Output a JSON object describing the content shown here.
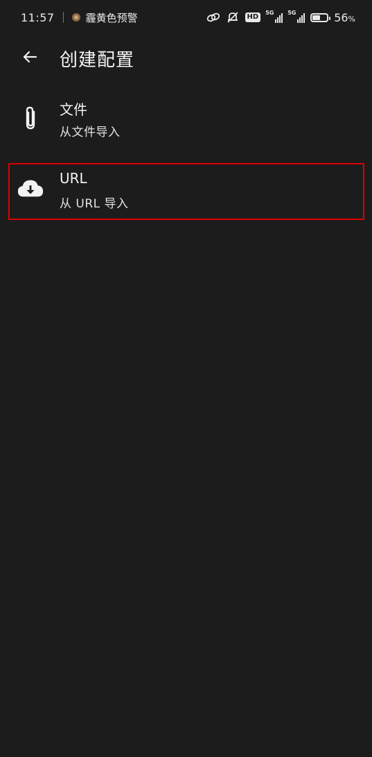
{
  "status_bar": {
    "time": "11:57",
    "alert_text": "霾黄色预警",
    "hd_label": "HD",
    "network_1": "5G",
    "network_2": "5G",
    "battery_percent": "56",
    "battery_unit": "%",
    "battery_level": 0.56,
    "icons": [
      "link-icon",
      "mute-icon",
      "hd-icon",
      "signal-icon",
      "battery-icon"
    ]
  },
  "app_bar": {
    "back_icon": "arrow-left-icon",
    "title": "创建配置"
  },
  "options": [
    {
      "icon": "paperclip-icon",
      "title": "文件",
      "subtitle": "从文件导入"
    },
    {
      "icon": "cloud-download-icon",
      "title": "URL",
      "subtitle": "从 URL 导入"
    }
  ],
  "colors": {
    "background": "#1c1c1c",
    "text": "#f2f2f2",
    "highlight_border": "#e00000"
  }
}
